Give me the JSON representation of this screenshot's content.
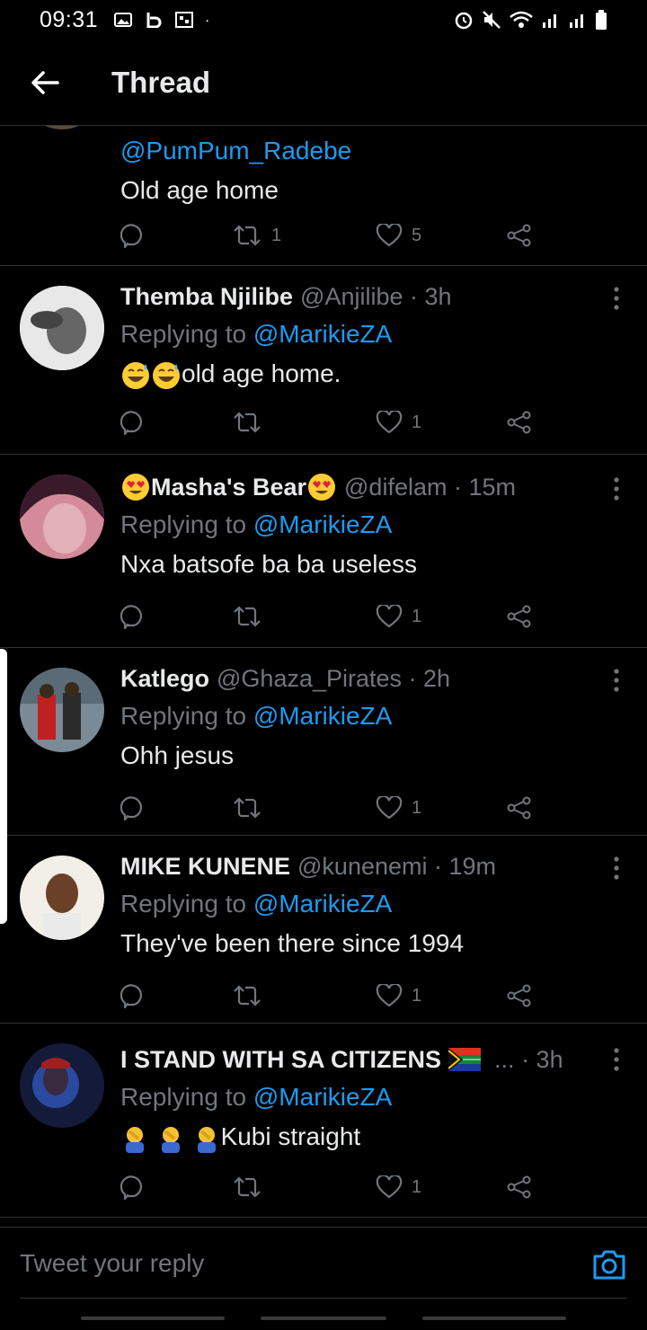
{
  "status_bar": {
    "time": "09:31",
    "left_icons": [
      "gallery-icon",
      "b-app-icon",
      "qr-icon",
      "dot-icon"
    ],
    "right_icons": [
      "alarm-icon",
      "mute-icon",
      "wifi-icon",
      "signal-icon",
      "signal-icon",
      "battery-icon"
    ]
  },
  "header": {
    "title": "Thread",
    "back_icon": "arrow-left-icon"
  },
  "partial_tweet": {
    "mention": "@PumPum_Radebe",
    "text": "Old age home",
    "retweets": "1",
    "likes": "5"
  },
  "tweets": [
    {
      "name": "Themba Njilibe",
      "handle": "@Anjilibe",
      "time": "· 3h",
      "reply_prefix": "Replying to",
      "reply_to": "@MarikieZA",
      "text": "old age home.",
      "retweets": "",
      "likes": "1"
    },
    {
      "name": "Masha's Bear",
      "handle": "@difelam",
      "time": "· 15m",
      "reply_prefix": "Replying to",
      "reply_to": "@MarikieZA",
      "text": "Nxa batsofe ba ba useless",
      "retweets": "",
      "likes": "1"
    },
    {
      "name": "Katlego",
      "handle": "@Ghaza_Pirates",
      "time": "· 2h",
      "reply_prefix": "Replying to",
      "reply_to": "@MarikieZA",
      "text": "Ohh jesus",
      "retweets": "",
      "likes": "1"
    },
    {
      "name": "MIKE KUNENE",
      "handle": "@kunenemi",
      "time": "· 19m",
      "reply_prefix": "Replying to",
      "reply_to": "@MarikieZA",
      "text": "They've been there since 1994",
      "retweets": "",
      "likes": "1"
    },
    {
      "name": "I STAND WITH SA CITIZENS",
      "handle": "...",
      "time": "· 3h",
      "reply_prefix": "Replying to",
      "reply_to": "@MarikieZA",
      "text": "Kubi straight",
      "retweets": "",
      "likes": "1"
    }
  ],
  "reply_bar": {
    "placeholder": "Tweet your reply",
    "camera_icon": "camera-icon"
  },
  "colors": {
    "background": "#000000",
    "accent": "#1d9bf0",
    "muted": "#71767b",
    "divider": "#2f3336"
  }
}
